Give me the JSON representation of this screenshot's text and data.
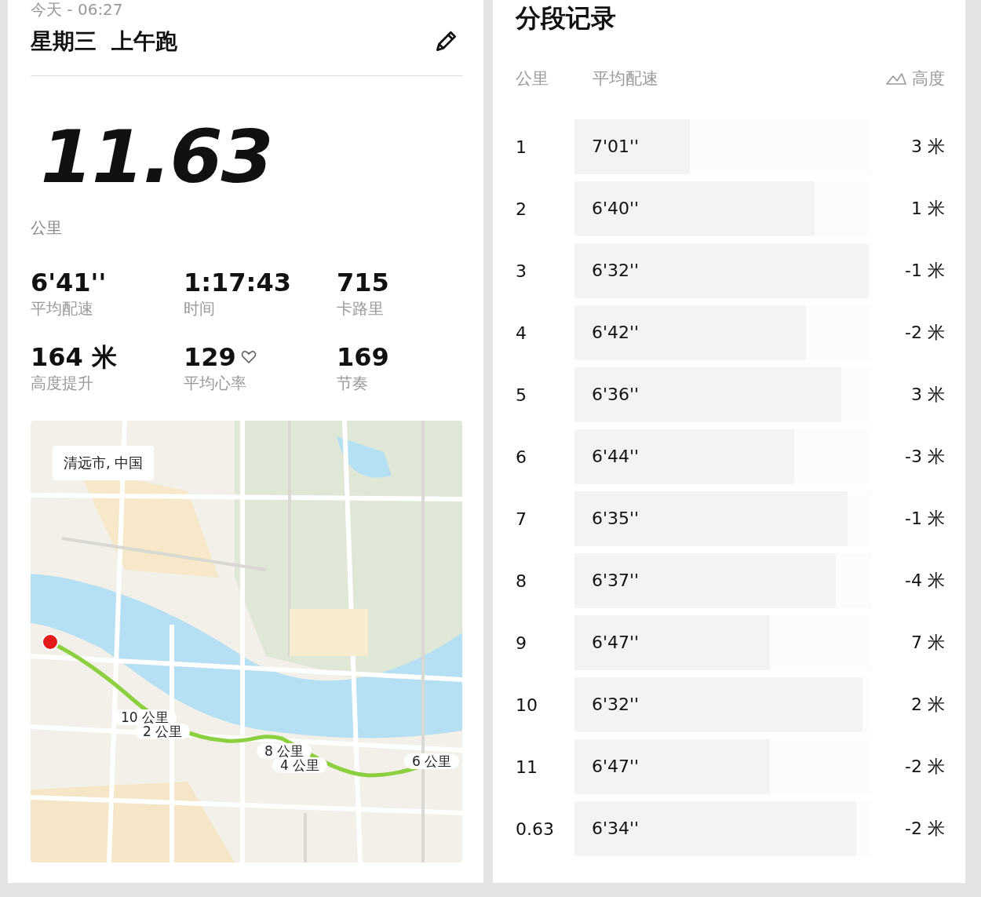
{
  "activity": {
    "date": "今天 - 06:27",
    "title": "星期三  上午跑"
  },
  "distance": {
    "value": "11.63",
    "unit": "公里"
  },
  "stats": [
    {
      "value": "6'41''",
      "label": "平均配速"
    },
    {
      "value": "1:17:43",
      "label": "时间"
    },
    {
      "value": "715",
      "label": "卡路里"
    },
    {
      "value": "164 米",
      "label": "高度提升"
    },
    {
      "value": "129",
      "label": "平均心率",
      "kind": "heart"
    },
    {
      "value": "169",
      "label": "节奏"
    }
  ],
  "map": {
    "place": "清远市, 中国",
    "markers": [
      {
        "label": "10 公里"
      },
      {
        "label": "2 公里"
      },
      {
        "label": "8 公里"
      },
      {
        "label": "4 公里"
      },
      {
        "label": "6 公里"
      }
    ]
  },
  "splits": {
    "title": "分段记录",
    "columns": {
      "km": "公里",
      "pace": "平均配速",
      "elevation": "高度"
    },
    "rows": [
      {
        "km": "1",
        "pace": "7'01''",
        "level": 0.39,
        "elevation": "3 米"
      },
      {
        "km": "2",
        "pace": "6'40''",
        "level": 0.81,
        "elevation": "1 米"
      },
      {
        "km": "3",
        "pace": "6'32''",
        "level": 0.99,
        "elevation": "-1 米"
      },
      {
        "km": "4",
        "pace": "6'42''",
        "level": 0.78,
        "elevation": "-2 米"
      },
      {
        "km": "5",
        "pace": "6'36''",
        "level": 0.9,
        "elevation": "3 米"
      },
      {
        "km": "6",
        "pace": "6'44''",
        "level": 0.74,
        "elevation": "-3 米"
      },
      {
        "km": "7",
        "pace": "6'35''",
        "level": 0.92,
        "elevation": "-1 米"
      },
      {
        "km": "8",
        "pace": "6'37''",
        "level": 0.88,
        "elevation": "-4 米"
      },
      {
        "km": "9",
        "pace": "6'47''",
        "level": 0.66,
        "elevation": "7 米"
      },
      {
        "km": "10",
        "pace": "6'32''",
        "level": 0.97,
        "elevation": "2 米"
      },
      {
        "km": "11",
        "pace": "6'47''",
        "level": 0.66,
        "elevation": "-2 米"
      },
      {
        "km": "0.63",
        "pace": "6'34''",
        "level": 0.95,
        "elevation": "-2 米"
      }
    ]
  }
}
